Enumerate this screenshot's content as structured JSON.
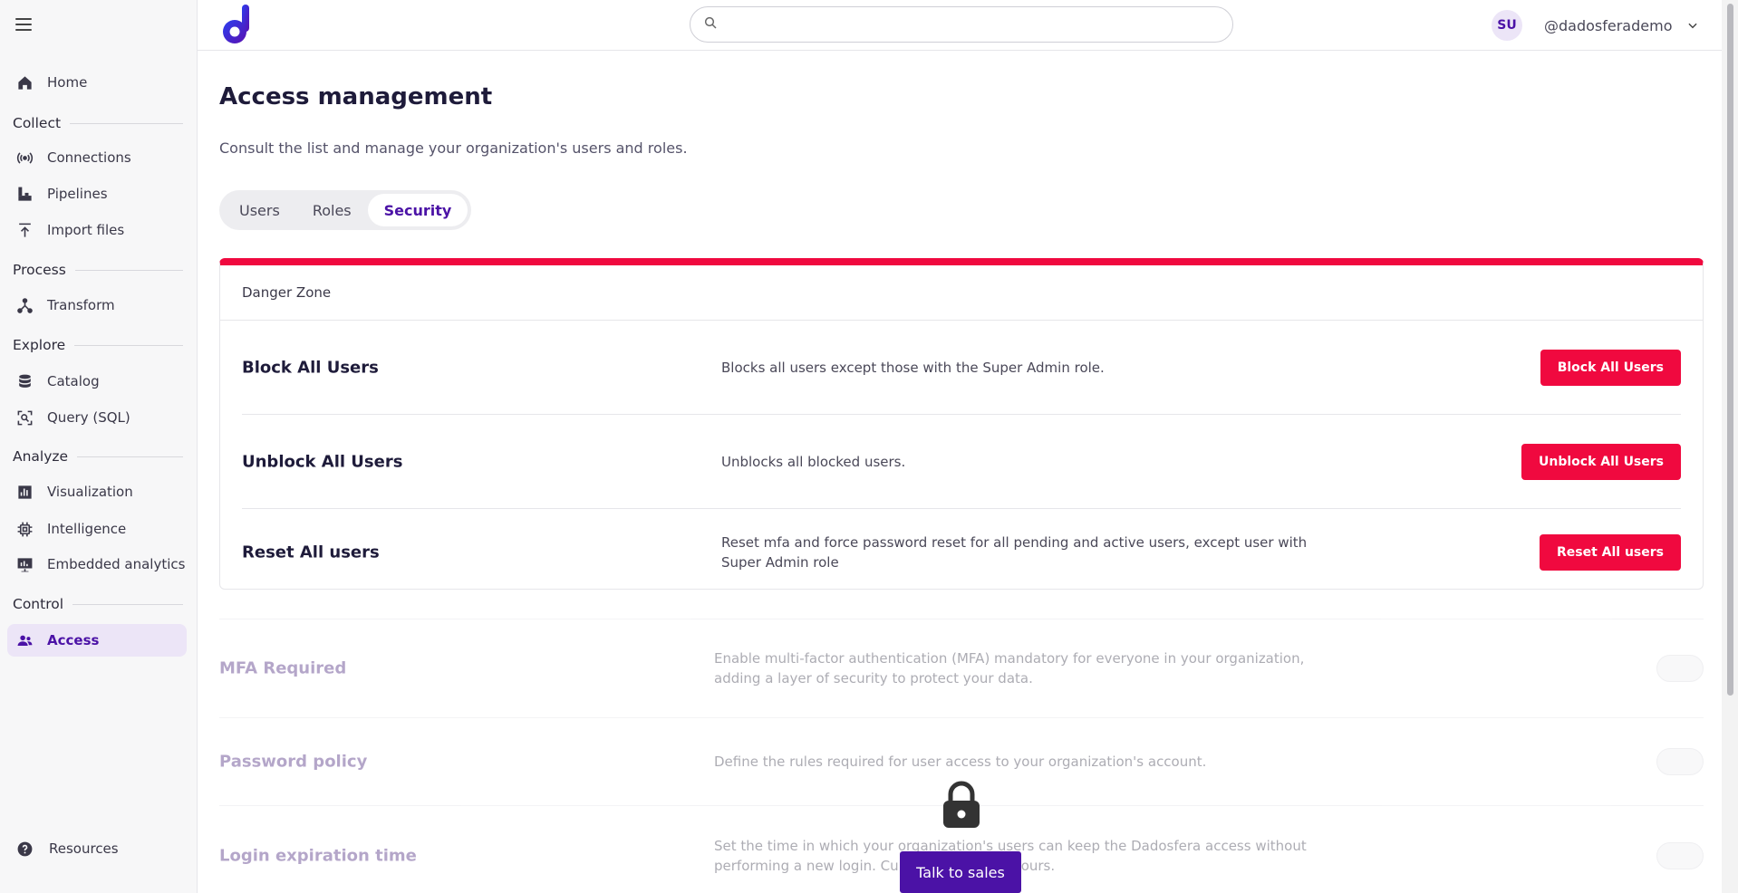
{
  "sidebar": {
    "menu_icon": "hamburger-menu-icon",
    "home": {
      "label": "Home",
      "icon": "home-icon"
    },
    "sections": {
      "collect": "Collect",
      "process": "Process",
      "explore": "Explore",
      "analyze": "Analyze",
      "control": "Control"
    },
    "connections": {
      "label": "Connections",
      "icon": "broadcast-icon"
    },
    "pipelines": {
      "label": "Pipelines",
      "icon": "pipeline-icon"
    },
    "import_files": {
      "label": "Import files",
      "icon": "upload-icon"
    },
    "transform": {
      "label": "Transform",
      "icon": "network-icon"
    },
    "catalog": {
      "label": "Catalog",
      "icon": "database-icon"
    },
    "query": {
      "label": "Query (SQL)",
      "icon": "query-search-icon"
    },
    "visualization": {
      "label": "Visualization",
      "icon": "bar-chart-icon"
    },
    "intelligence": {
      "label": "Intelligence",
      "icon": "chip-icon"
    },
    "embedded": {
      "label": "Embedded analytics",
      "icon": "presentation-chart-icon"
    },
    "access": {
      "label": "Access",
      "icon": "users-icon"
    },
    "resources": {
      "label": "Resources",
      "icon": "help-circle-icon"
    }
  },
  "topbar": {
    "search_placeholder": "",
    "avatar_initials": "SU",
    "username": "@dadosferademo"
  },
  "page": {
    "title": "Access management",
    "subtitle": "Consult the list and manage your organization's users and roles.",
    "tabs": [
      "Users",
      "Roles",
      "Security"
    ],
    "active_tab": "Security"
  },
  "danger_zone": {
    "title": "Danger Zone",
    "rows": [
      {
        "title": "Block All Users",
        "description": "Blocks all users except those with the Super Admin role.",
        "button": "Block All Users"
      },
      {
        "title": "Unblock All Users",
        "description": "Unblocks all blocked users.",
        "button": "Unblock All Users"
      },
      {
        "title": "Reset All users",
        "description": "Reset mfa and force password reset for all pending and active users, except user with Super Admin role",
        "button": "Reset All users"
      }
    ]
  },
  "locked_settings": [
    {
      "title": "MFA Required",
      "description": "Enable multi-factor authentication (MFA) mandatory for everyone in your organization, adding a layer of security to protect your data.",
      "enabled": false
    },
    {
      "title": "Password policy",
      "description": "Define the rules required for user access to your organization's account.",
      "enabled": false
    },
    {
      "title": "Login expiration time",
      "description": "Set the time in which your organization's users can keep the Dadosfera access without performing a new login. Currently set to 24 hours.",
      "enabled": false
    }
  ],
  "overlay": {
    "lock_icon": "lock-icon",
    "cta_label": "Talk to sales"
  },
  "colors": {
    "brand": "#4b12a6",
    "danger": "#f0093f",
    "sidebar_bg": "#f7f7f8",
    "active_bg": "#ece5f7"
  }
}
